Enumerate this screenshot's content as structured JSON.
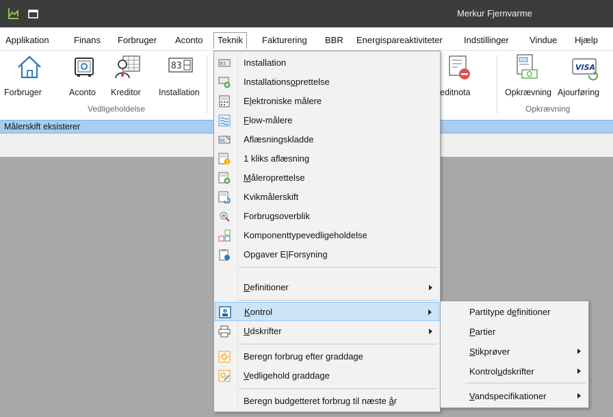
{
  "window": {
    "title": "Merkur Fjernvarme"
  },
  "menubar": {
    "items": [
      {
        "label": "Applikation"
      },
      {
        "label": "Finans"
      },
      {
        "label": "Forbruger"
      },
      {
        "label": "Aconto"
      },
      {
        "label": "Teknik"
      },
      {
        "label": "Fakturering"
      },
      {
        "label": "BBR"
      },
      {
        "label": "Energispareaktiviteter"
      },
      {
        "label": "Indstillinger"
      },
      {
        "label": "Vindue"
      },
      {
        "label": "Hjælp"
      }
    ]
  },
  "ribbon": {
    "buttons": [
      {
        "label": "Forbruger",
        "icon": "house-icon"
      },
      {
        "label": "Aconto",
        "icon": "safe-icon"
      },
      {
        "label": "Kreditor",
        "icon": "person-table-icon"
      },
      {
        "label": "Installation",
        "icon": "meter-digits-icon"
      },
      {
        "label": "editnota",
        "icon": "credit-note-icon"
      },
      {
        "label": "Opkrævning",
        "icon": "invoice-money-icon"
      },
      {
        "label": "Ajourføring",
        "icon": "visa-card-icon"
      }
    ],
    "groups": [
      {
        "label": "Vedligeholdelse"
      },
      {
        "label": "Opkrævning"
      }
    ]
  },
  "status": {
    "text": "Målerskift eksisterer"
  },
  "teknik_menu": {
    "items": [
      {
        "label": "Installation",
        "icon": "meter-icon"
      },
      {
        "label": "Installationsoprettelse",
        "icon": "meter-add-icon"
      },
      {
        "label": "Elektroniske målere",
        "icon": "electronic-meter-icon"
      },
      {
        "label": "Flow-målere",
        "icon": "flow-meter-icon"
      },
      {
        "label": "Aflæsningskladde",
        "icon": "reading-draft-icon"
      },
      {
        "label": "1 kliks aflæsning",
        "icon": "one-click-reading-icon"
      },
      {
        "label": "Måleroprettelse",
        "icon": "meter-create-icon"
      },
      {
        "label": "Kvikmålerskift",
        "icon": "quick-meter-change-icon"
      },
      {
        "label": "Forbrugsoverblik",
        "icon": "consumption-overview-icon"
      },
      {
        "label": "Komponenttypevedligeholdelse",
        "icon": "component-type-icon"
      },
      {
        "label": "Opgaver E|Forsyning",
        "icon": "tasks-icon"
      },
      {
        "label": "Definitioner",
        "icon": ""
      },
      {
        "label": "Kontrol",
        "icon": "control-icon"
      },
      {
        "label": "Udskrifter",
        "icon": "printer-icon"
      },
      {
        "label": "Beregn forbrug efter graddage",
        "icon": "degree-day-icon"
      },
      {
        "label": "Vedligehold graddage",
        "icon": "degree-day-edit-icon"
      },
      {
        "label": "Beregn budgetteret forbrug til næste år",
        "icon": ""
      }
    ]
  },
  "kontrol_submenu": {
    "items": [
      {
        "label": "Partitype definitioner"
      },
      {
        "label": "Partier"
      },
      {
        "label": "Stikprøver"
      },
      {
        "label": "Kontroludskrifter"
      },
      {
        "label": "Vandspecifikationer"
      }
    ]
  },
  "colors": {
    "titlebar": "#3c3c3c",
    "status_strip": "#a9cdf0",
    "workspace": "#a8a8a8",
    "menu_bg": "#f2f2f2",
    "highlight": "#cce4f7"
  }
}
